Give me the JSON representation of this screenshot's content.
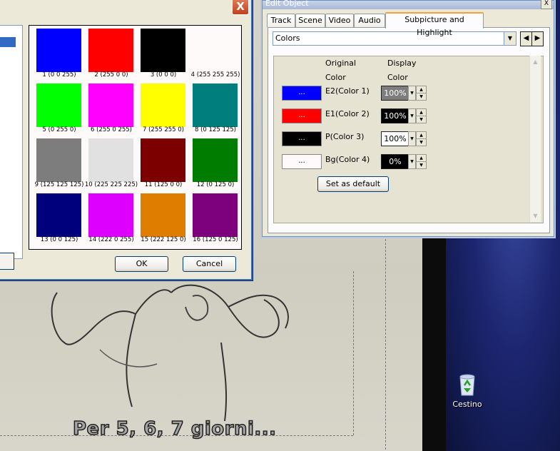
{
  "video": {
    "subtitle": "Per 5, 6, 7 giorni..."
  },
  "desktop": {
    "recycle_bin_label": "Cestino"
  },
  "color_dialog": {
    "close_glyph": "X",
    "swatches": [
      {
        "label": "1 (0 0 255)",
        "color": "#0000ff"
      },
      {
        "label": "2 (255 0 0)",
        "color": "#ff0000"
      },
      {
        "label": "3 (0 0 0)",
        "color": "#000000"
      },
      {
        "label": "4 (255 255 255)",
        "color": "#fffafa"
      },
      {
        "label": "5 (0 255 0)",
        "color": "#00ff00"
      },
      {
        "label": "6 (255 0 255)",
        "color": "#ff00ff"
      },
      {
        "label": "7 (255 255 0)",
        "color": "#ffff00"
      },
      {
        "label": "8 (0 125 125)",
        "color": "#007d7d"
      },
      {
        "label": "9 (125 125 125)",
        "color": "#7d7d7d"
      },
      {
        "label": "10 (225 225 225)",
        "color": "#e1e1e1"
      },
      {
        "label": "11 (125 0 0)",
        "color": "#7d0000"
      },
      {
        "label": "12 (0 125 0)",
        "color": "#007d00"
      },
      {
        "label": "13 (0 0 125)",
        "color": "#00007d"
      },
      {
        "label": "14 (222 0 255)",
        "color": "#de00ff"
      },
      {
        "label": "15 (222 125 0)",
        "color": "#de7d00"
      },
      {
        "label": "16 (125 0 125)",
        "color": "#7d007d"
      }
    ],
    "ok_label": "OK",
    "cancel_label": "Cancel"
  },
  "edit_object": {
    "title": "Edit Object",
    "close_glyph": "X",
    "tabs": [
      {
        "label": "Track"
      },
      {
        "label": "Scene"
      },
      {
        "label": "Video"
      },
      {
        "label": "Audio"
      },
      {
        "label": "Subpicture and Highlight",
        "active": true
      }
    ],
    "dropdown_value": "Colors",
    "headers": {
      "original_1": "Original",
      "original_2": "Color",
      "display_1": "Display",
      "display_2": "Color"
    },
    "rows": [
      {
        "button_text": "...",
        "swatch": "#0000ff",
        "label": "E2(Color 1)",
        "display_value": "100%",
        "display_color": "#7d7d7d",
        "display_text_color": "#ffffff"
      },
      {
        "button_text": "...",
        "swatch": "#ff0000",
        "label": "E1(Color 2)",
        "display_value": "100%",
        "display_color": "#000000",
        "display_text_color": "#ffffff"
      },
      {
        "button_text": "...",
        "swatch": "#000000",
        "label": "P(Color 3)",
        "display_value": "100%",
        "display_color": "#ffffff",
        "display_text_color": "#000000"
      },
      {
        "button_text": "...",
        "swatch": "#fffafa",
        "label": "Bg(Color 4)",
        "display_value": "0%",
        "display_color": "#000000",
        "display_text_color": "#ffffff"
      }
    ],
    "set_default_label": "Set as default"
  }
}
